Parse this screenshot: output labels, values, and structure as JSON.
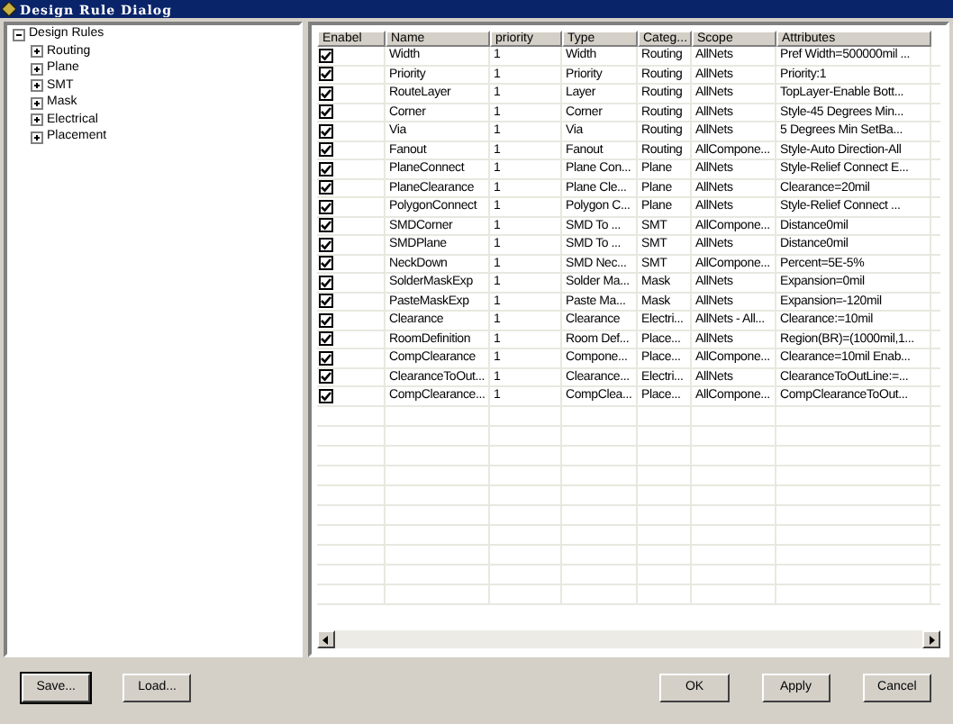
{
  "window": {
    "title": "Design Rule Dialog"
  },
  "tree": {
    "label": "Design Rules",
    "expanded": true,
    "children": [
      {
        "label": "Routing",
        "expanded": false
      },
      {
        "label": "Plane",
        "expanded": false
      },
      {
        "label": "SMT",
        "expanded": false
      },
      {
        "label": "Mask",
        "expanded": false
      },
      {
        "label": "Electrical",
        "expanded": false
      },
      {
        "label": "Placement",
        "expanded": false
      }
    ]
  },
  "table": {
    "columns": [
      "Enabel",
      "Name",
      "priority",
      "Type",
      "Categ...",
      "Scope",
      "Attributes"
    ],
    "rows": [
      {
        "enabel": true,
        "name": "Width",
        "priority": "1",
        "type": "Width",
        "category": "Routing",
        "scope": "AllNets",
        "attributes": "Pref Width=500000mil ..."
      },
      {
        "enabel": true,
        "name": "Priority",
        "priority": "1",
        "type": "Priority",
        "category": "Routing",
        "scope": "AllNets",
        "attributes": "Priority:1"
      },
      {
        "enabel": true,
        "name": "RouteLayer",
        "priority": "1",
        "type": "Layer",
        "category": "Routing",
        "scope": "AllNets",
        "attributes": "TopLayer-Enable  Bott..."
      },
      {
        "enabel": true,
        "name": "Corner",
        "priority": "1",
        "type": "Corner",
        "category": "Routing",
        "scope": "AllNets",
        "attributes": "Style-45 Degrees  Min..."
      },
      {
        "enabel": true,
        "name": "Via",
        "priority": "1",
        "type": "Via",
        "category": "Routing",
        "scope": "AllNets",
        "attributes": "5 Degrees  Min SetBa..."
      },
      {
        "enabel": true,
        "name": "Fanout",
        "priority": "1",
        "type": "Fanout",
        "category": "Routing",
        "scope": "AllCompone...",
        "attributes": "Style-Auto Direction-All"
      },
      {
        "enabel": true,
        "name": "PlaneConnect",
        "priority": "1",
        "type": "Plane Con...",
        "category": "Plane",
        "scope": "AllNets",
        "attributes": "Style-Relief Connect  E..."
      },
      {
        "enabel": true,
        "name": "PlaneClearance",
        "priority": "1",
        "type": "Plane Cle...",
        "category": "Plane",
        "scope": "AllNets",
        "attributes": "Clearance=20mil"
      },
      {
        "enabel": true,
        "name": "PolygonConnect",
        "priority": "1",
        "type": "Polygon C...",
        "category": "Plane",
        "scope": "AllNets",
        "attributes": "Style-Relief Connect  ..."
      },
      {
        "enabel": true,
        "name": "SMDCorner",
        "priority": "1",
        "type": "SMD To ...",
        "category": "SMT",
        "scope": "AllCompone...",
        "attributes": "Distance0mil"
      },
      {
        "enabel": true,
        "name": "SMDPlane",
        "priority": "1",
        "type": "SMD To ...",
        "category": "SMT",
        "scope": "AllNets",
        "attributes": "Distance0mil"
      },
      {
        "enabel": true,
        "name": "NeckDown",
        "priority": "1",
        "type": "SMD Nec...",
        "category": "SMT",
        "scope": "AllCompone...",
        "attributes": "Percent=5E-5%"
      },
      {
        "enabel": true,
        "name": "SolderMaskExp",
        "priority": "1",
        "type": "Solder Ma...",
        "category": "Mask",
        "scope": "AllNets",
        "attributes": "Expansion=0mil"
      },
      {
        "enabel": true,
        "name": "PasteMaskExp",
        "priority": "1",
        "type": "Paste Ma...",
        "category": "Mask",
        "scope": "AllNets",
        "attributes": "Expansion=-120mil"
      },
      {
        "enabel": true,
        "name": "Clearance",
        "priority": "1",
        "type": "Clearance",
        "category": "Electri...",
        "scope": "AllNets - All...",
        "attributes": "Clearance:=10mil"
      },
      {
        "enabel": true,
        "name": "RoomDefinition",
        "priority": "1",
        "type": "Room Def...",
        "category": "Place...",
        "scope": "AllNets",
        "attributes": "Region(BR)=(1000mil,1..."
      },
      {
        "enabel": true,
        "name": "CompClearance",
        "priority": "1",
        "type": "Compone...",
        "category": "Place...",
        "scope": "AllCompone...",
        "attributes": "Clearance=10mil  Enab..."
      },
      {
        "enabel": true,
        "name": "ClearanceToOut...",
        "priority": "1",
        "type": "Clearance...",
        "category": "Electri...",
        "scope": "AllNets",
        "attributes": "ClearanceToOutLine:=..."
      },
      {
        "enabel": true,
        "name": "CompClearance...",
        "priority": "1",
        "type": "CompClea...",
        "category": "Place...",
        "scope": "AllCompone...",
        "attributes": "CompClearanceToOut..."
      }
    ]
  },
  "buttons": [
    {
      "label": "Save...",
      "default": true
    },
    {
      "label": "Load...",
      "default": false
    },
    {
      "label": "OK",
      "default": false
    },
    {
      "label": "Apply",
      "default": false
    },
    {
      "label": "Cancel",
      "default": false
    }
  ]
}
